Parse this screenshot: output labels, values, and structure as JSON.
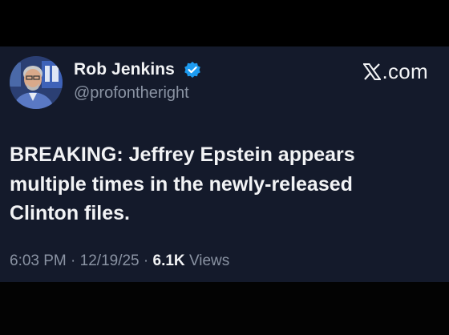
{
  "tweet": {
    "author": {
      "display_name": "Rob Jenkins",
      "handle": "@profontheright",
      "verified": true,
      "avatar_icon": "profile-photo"
    },
    "site_label": ".com",
    "site_icon": "x-logo-icon",
    "text_lines": [
      "BREAKING: Jeffrey Epstein appears",
      "multiple times in the newly-released",
      "Clinton files."
    ],
    "time": "6:03 PM",
    "date": "12/19/25",
    "separator": "·",
    "views_count": "6.1K",
    "views_label": "Views"
  },
  "colors": {
    "background": "#000000",
    "card": "#141a2b",
    "text_primary": "#f2f3f5",
    "text_secondary": "#8a93a3",
    "verified_badge": "#1d9bf0"
  }
}
